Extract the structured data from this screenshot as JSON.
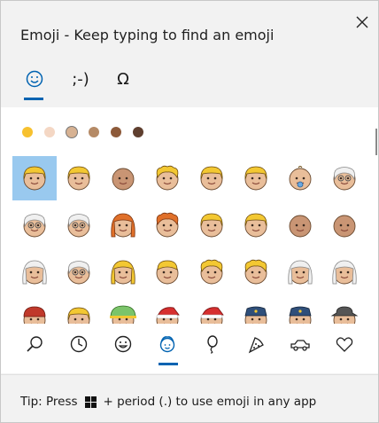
{
  "window": {
    "title": "Emoji - Keep typing to find an emoji"
  },
  "tabs": [
    {
      "name": "emoji",
      "glyph": "☺",
      "active": true
    },
    {
      "name": "kaomoji",
      "glyph": ";-)",
      "active": false
    },
    {
      "name": "symbols",
      "glyph": "Ω",
      "active": false
    }
  ],
  "skin_tones": [
    "#f7c12f",
    "#f4d7c4",
    "#d7b293",
    "#b58a66",
    "#8d5a3a",
    "#5f3f2f"
  ],
  "selected_tone_index": 2,
  "emoji_rows": [
    [
      "person-blond",
      "person-blond",
      "person-bald",
      "person-curly",
      "person-blond",
      "person-blond",
      "baby",
      "older-person"
    ],
    [
      "older-man",
      "older-man",
      "woman-red-hair",
      "man-red-hair",
      "person-blond",
      "person-blond",
      "person-bald",
      "person-bald"
    ],
    [
      "older-woman",
      "older-man",
      "woman-blond",
      "man-blond",
      "woman-curly",
      "man-curly",
      "older-woman",
      "older-woman-white"
    ],
    [
      "person-cap",
      "person-blond",
      "person-helmet",
      "santa",
      "santa",
      "police-officer",
      "police-officer",
      "detective"
    ]
  ],
  "categories": [
    {
      "name": "search",
      "active": false
    },
    {
      "name": "recent",
      "active": false
    },
    {
      "name": "smiley",
      "active": false
    },
    {
      "name": "people",
      "active": true
    },
    {
      "name": "celebration",
      "active": false
    },
    {
      "name": "food",
      "active": false
    },
    {
      "name": "travel",
      "active": false
    },
    {
      "name": "heart",
      "active": false
    }
  ],
  "tip": {
    "prefix": "Tip: Press",
    "suffix": "+ period (.) to use emoji in any app"
  },
  "colors": {
    "accent": "#0063b1",
    "selection": "#99c9ef"
  }
}
